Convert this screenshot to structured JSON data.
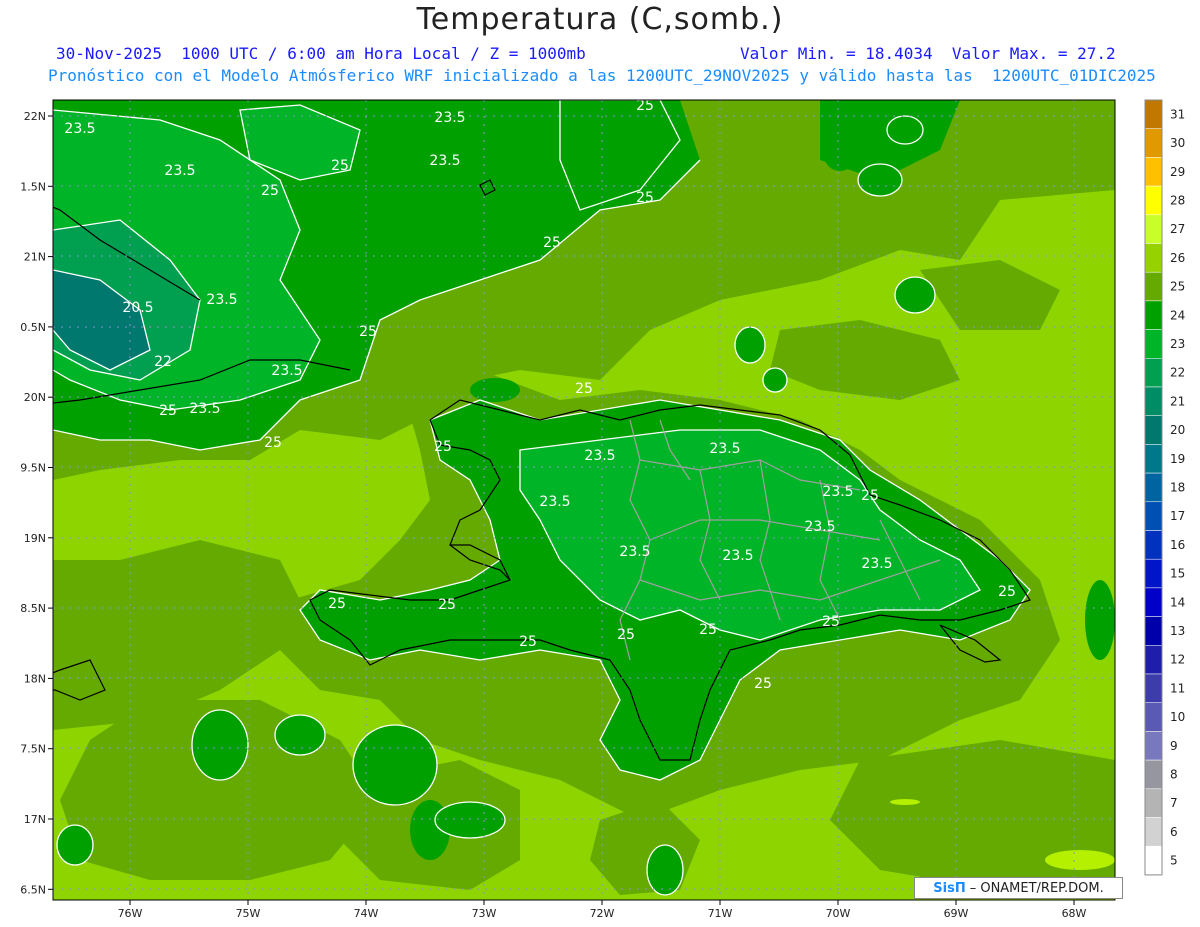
{
  "header": {
    "title": "Temperatura (C,somb.)",
    "line1_left": "30-Nov-2025  1000 UTC / 6:00 am Hora Local / Z = 1000mb",
    "line1_right": "Valor Min. = 18.4034  Valor Max. = 27.2",
    "line2": "Pronóstico con el Modelo Atmósferico WRF inicializado a las 1200UTC_29NOV2025 y válido hasta las  1200UTC_01DIC2025"
  },
  "axes": {
    "lat_labels": [
      "22N",
      "1.5N",
      "21N",
      "0.5N",
      "20N",
      "9.5N",
      "19N",
      "8.5N",
      "18N",
      "7.5N",
      "17N",
      "6.5N"
    ],
    "lon_labels": [
      "76W",
      "75W",
      "74W",
      "73W",
      "72W",
      "71W",
      "70W",
      "69W",
      "68W"
    ]
  },
  "colorbar": {
    "levels": [
      "31",
      "30",
      "29",
      "28",
      "27",
      "26",
      "25",
      "24",
      "23",
      "22",
      "21",
      "20",
      "19",
      "18",
      "17",
      "16",
      "15",
      "14",
      "13",
      "12",
      "11",
      "10",
      "9",
      "8",
      "7",
      "6",
      "5"
    ],
    "colors": [
      "#c07800",
      "#e09a00",
      "#ffc000",
      "#ffff00",
      "#c8ff28",
      "#96d200",
      "#64aa00",
      "#00a000",
      "#00b428",
      "#00a050",
      "#008c64",
      "#00786e",
      "#00788c",
      "#0064a0",
      "#0050b4",
      "#0032be",
      "#0014c8",
      "#0000c8",
      "#0000aa",
      "#1e1eaa",
      "#3c3caa",
      "#5a5ab4",
      "#7878be",
      "#9696a0",
      "#b4b4b4",
      "#d2d2d2",
      "#ffffff"
    ]
  },
  "contour_labels": [
    "23.5",
    "23.5",
    "23.5",
    "23.5",
    "25",
    "25",
    "25",
    "25",
    "25",
    "20.5",
    "23.5",
    "22",
    "23.5",
    "23.5",
    "25",
    "25",
    "25",
    "23.5",
    "23.5",
    "23.5",
    "23.5",
    "23.5",
    "23.5",
    "23.5",
    "23.5",
    "25",
    "25",
    "25",
    "25",
    "25",
    "25",
    "25",
    "25",
    "25",
    "25",
    "25"
  ],
  "credit": {
    "brand": "SisΠ",
    "text": "– ONAMET/REP.DOM."
  }
}
